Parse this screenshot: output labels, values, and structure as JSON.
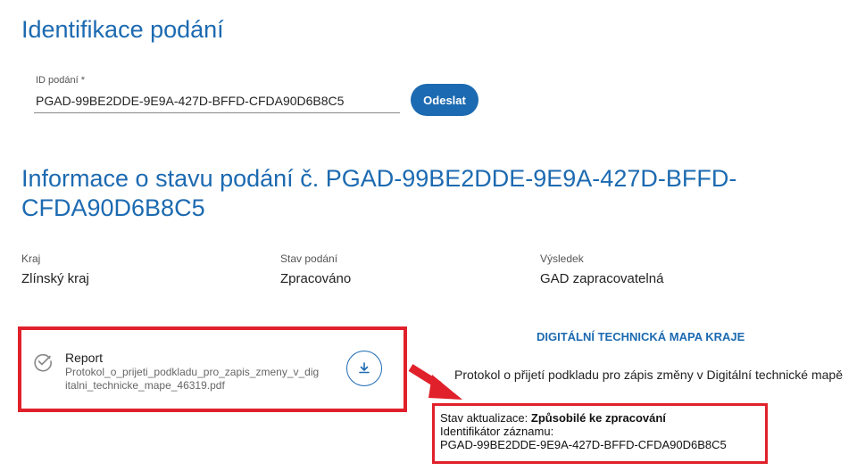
{
  "header": {
    "title": "Identifikace podání"
  },
  "form": {
    "id_label": "ID podání *",
    "id_value": "PGAD-99BE2DDE-9E9A-427D-BFFD-CFDA90D6B8C5",
    "submit_label": "Odeslat"
  },
  "status": {
    "title": "Informace o stavu podání č. PGAD-99BE2DDE-9E9A-427D-BFFD-CFDA90D6B8C5",
    "fields": [
      {
        "label": "Kraj",
        "value": "Zlínský kraj"
      },
      {
        "label": "Stav podání",
        "value": "Zpracováno"
      },
      {
        "label": "Výsledek",
        "value": "GAD zapracovatelná"
      }
    ]
  },
  "report": {
    "title": "Report",
    "file_line1": "Protokol_o_prijeti_podkladu_pro_zapis_zmeny_v_dig",
    "file_line2": "italni_technicke_mape_46319.pdf",
    "icon": "check-circle-icon",
    "download_icon": "download-icon"
  },
  "dtm": {
    "heading": "DIGITÁLNÍ TECHNICKÁ MAPA KRAJE",
    "protocol_title": "Protokol o přijetí podkladu pro zápis změny v Digitální technické mapě",
    "update_status_label": "Stav aktualizace:",
    "update_status_value": "Způsobilé ke zpracování",
    "record_id_label": "Identifikátor záznamu:",
    "record_id_value": "PGAD-99BE2DDE-9E9A-427D-BFFD-CFDA90D6B8C5"
  },
  "colors": {
    "accent": "#1c6ab1",
    "highlight": "#e0202a"
  }
}
